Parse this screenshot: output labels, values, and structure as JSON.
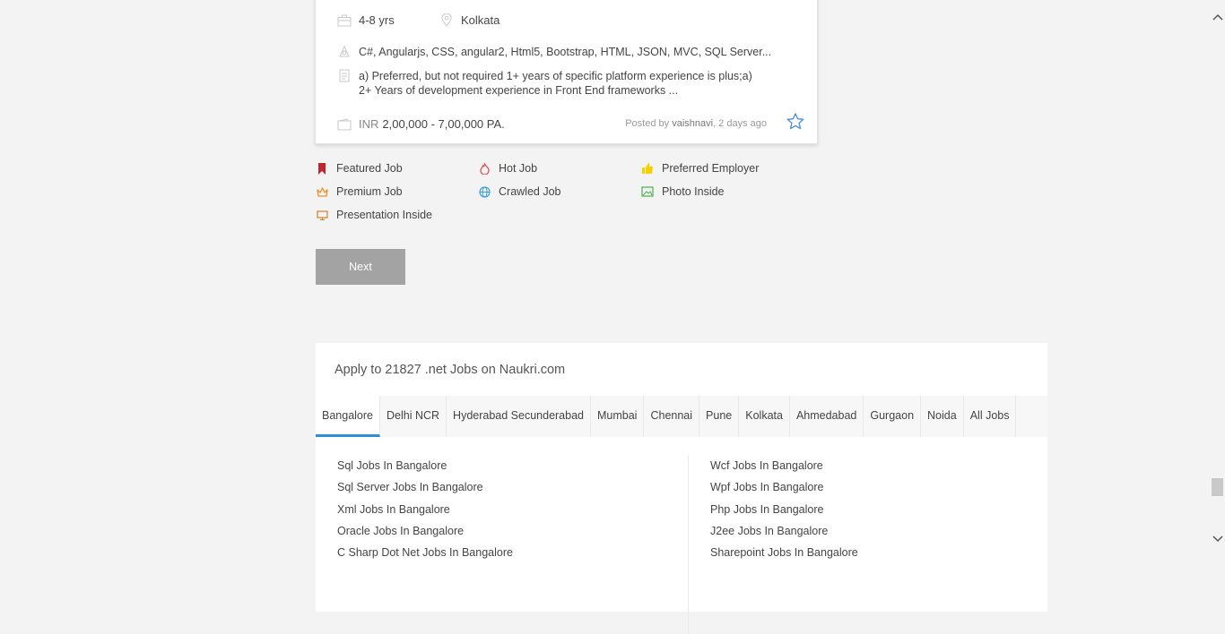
{
  "job": {
    "experience": "4-8 yrs",
    "location": "Kolkata",
    "skills": "C#, Angularjs, CSS, angular2, Html5, Bootstrap, HTML, JSON, MVC, SQL Server...",
    "desc_line1": "a) Preferred, but not required 1+ years of specific platform experience is plus;a)",
    "desc_line2": "2+ Years of development experience in Front End frameworks ...",
    "currency": "INR",
    "salary": "2,00,000 - 7,00,000 PA.",
    "posted_prefix": "Posted by",
    "posted_by": "vaishnavi",
    "posted_when": ", 2 days ago"
  },
  "legend": {
    "featured": "Featured Job",
    "hot": "Hot Job",
    "preferred": "Preferred Employer",
    "premium": "Premium Job",
    "crawled": "Crawled Job",
    "photo": "Photo Inside",
    "presentation": "Presentation Inside"
  },
  "pagination": {
    "next_label": "Next"
  },
  "apply": {
    "title": "Apply to 21827 .net Jobs on Naukri.com",
    "tabs": [
      "Bangalore",
      "Delhi NCR",
      "Hyderabad Secunderabad",
      "Mumbai",
      "Chennai",
      "Pune",
      "Kolkata",
      "Ahmedabad",
      "Gurgaon",
      "Noida",
      "All Jobs"
    ],
    "active_tab": "Bangalore",
    "links_left": [
      "Sql Jobs In Bangalore",
      "Sql Server Jobs In Bangalore",
      "Xml Jobs In Bangalore",
      "Oracle Jobs In Bangalore",
      "C Sharp Dot Net Jobs In Bangalore"
    ],
    "links_right": [
      "Wcf Jobs In Bangalore",
      "Wpf Jobs In Bangalore",
      "Php Jobs In Bangalore",
      "J2ee Jobs In Bangalore",
      "Sharepoint Jobs In Bangalore"
    ]
  },
  "colors": {
    "accent": "#2a8fd4",
    "featured": "#c0272d",
    "hot": "#d9534f",
    "preferred": "#f5d100",
    "premium": "#e8912d",
    "crawled": "#3aa0d8",
    "photo": "#4caf50",
    "presentation": "#d77c2c"
  }
}
